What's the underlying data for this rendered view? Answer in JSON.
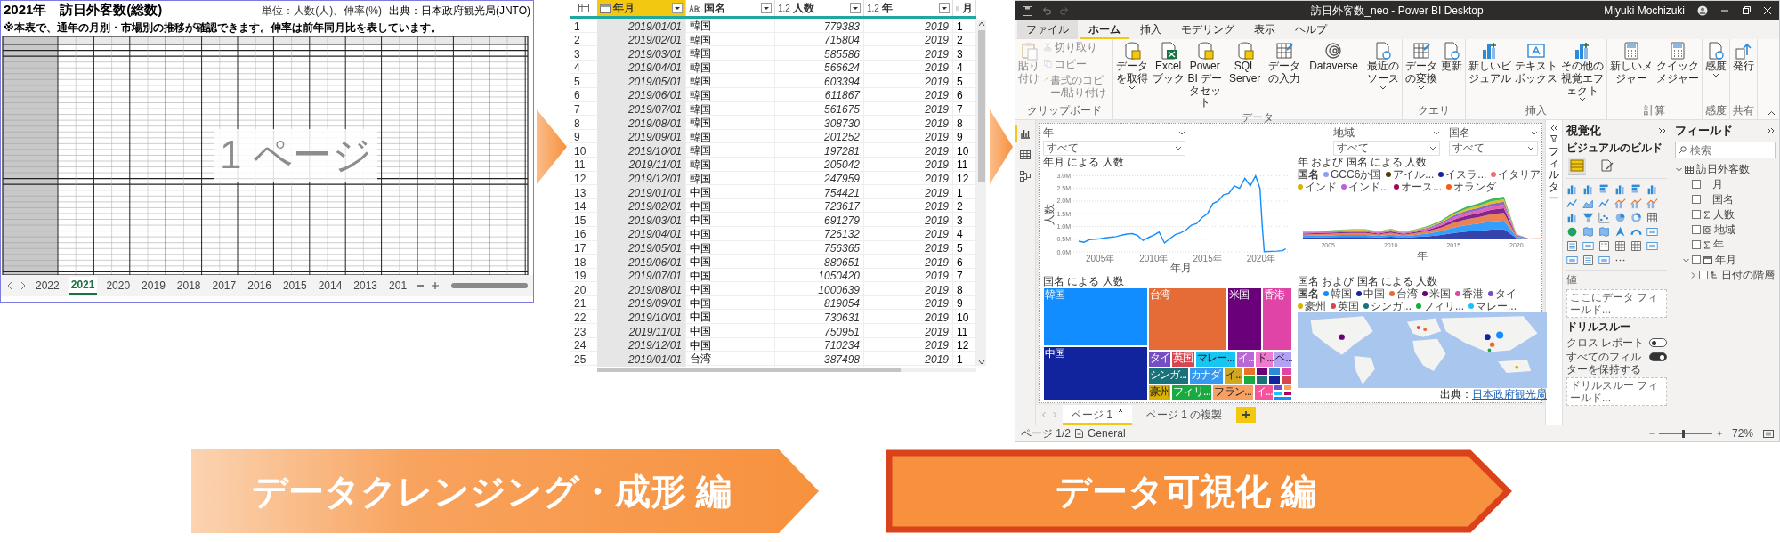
{
  "excel": {
    "title": "2021年　訪日外客数(総数)",
    "source": "出典：日本政府観光局(JNTO)",
    "note": "※本表で、通年の月別・市場別の推移が確認できます。伸率は前年同月比を表しています。",
    "unit": "単位：人数(人)、伸率(%)",
    "page_label": "1 ページ",
    "sheet_tabs": [
      {
        "label": "2022",
        "selected": false
      },
      {
        "label": "2021",
        "selected": true
      },
      {
        "label": "2020",
        "selected": false
      },
      {
        "label": "2019",
        "selected": false
      },
      {
        "label": "2018",
        "selected": false
      },
      {
        "label": "2017",
        "selected": false
      },
      {
        "label": "2016",
        "selected": false
      },
      {
        "label": "2015",
        "selected": false
      },
      {
        "label": "2014",
        "selected": false
      },
      {
        "label": "2013",
        "selected": false
      },
      {
        "label": "201",
        "selected": false
      }
    ]
  },
  "query_editor": {
    "columns": [
      {
        "kind": "date",
        "name": "年月",
        "selected": true,
        "menu": true
      },
      {
        "kind": "text",
        "name": "国名",
        "selected": false,
        "menu": true
      },
      {
        "kind": "number",
        "type_label": "1.2",
        "name": "人数",
        "selected": false,
        "menu": true
      },
      {
        "kind": "number",
        "type_label": "1.2",
        "name": "年",
        "selected": false,
        "menu": true
      },
      {
        "kind": "any",
        "name": "月",
        "selected": false,
        "menu": false
      }
    ],
    "rows": [
      {
        "index": "1",
        "cells": [
          "2019/01/01",
          "韓国",
          "779383",
          "2019",
          "1"
        ]
      },
      {
        "index": "2",
        "cells": [
          "2019/02/01",
          "韓国",
          "715804",
          "2019",
          "2"
        ]
      },
      {
        "index": "3",
        "cells": [
          "2019/03/01",
          "韓国",
          "585586",
          "2019",
          "3"
        ]
      },
      {
        "index": "4",
        "cells": [
          "2019/04/01",
          "韓国",
          "566624",
          "2019",
          "4"
        ]
      },
      {
        "index": "5",
        "cells": [
          "2019/05/01",
          "韓国",
          "603394",
          "2019",
          "5"
        ]
      },
      {
        "index": "6",
        "cells": [
          "2019/06/01",
          "韓国",
          "611867",
          "2019",
          "6"
        ]
      },
      {
        "index": "7",
        "cells": [
          "2019/07/01",
          "韓国",
          "561675",
          "2019",
          "7"
        ]
      },
      {
        "index": "8",
        "cells": [
          "2019/08/01",
          "韓国",
          "308730",
          "2019",
          "8"
        ]
      },
      {
        "index": "9",
        "cells": [
          "2019/09/01",
          "韓国",
          "201252",
          "2019",
          "9"
        ]
      },
      {
        "index": "10",
        "cells": [
          "2019/10/01",
          "韓国",
          "197281",
          "2019",
          "10"
        ]
      },
      {
        "index": "11",
        "cells": [
          "2019/11/01",
          "韓国",
          "205042",
          "2019",
          "11"
        ]
      },
      {
        "index": "12",
        "cells": [
          "2019/12/01",
          "韓国",
          "247959",
          "2019",
          "12"
        ]
      },
      {
        "index": "13",
        "cells": [
          "2019/01/01",
          "中国",
          "754421",
          "2019",
          "1"
        ]
      },
      {
        "index": "14",
        "cells": [
          "2019/02/01",
          "中国",
          "723617",
          "2019",
          "2"
        ]
      },
      {
        "index": "15",
        "cells": [
          "2019/03/01",
          "中国",
          "691279",
          "2019",
          "3"
        ]
      },
      {
        "index": "16",
        "cells": [
          "2019/04/01",
          "中国",
          "726132",
          "2019",
          "4"
        ]
      },
      {
        "index": "17",
        "cells": [
          "2019/05/01",
          "中国",
          "756365",
          "2019",
          "5"
        ]
      },
      {
        "index": "18",
        "cells": [
          "2019/06/01",
          "中国",
          "880651",
          "2019",
          "6"
        ]
      },
      {
        "index": "19",
        "cells": [
          "2019/07/01",
          "中国",
          "1050420",
          "2019",
          "7"
        ]
      },
      {
        "index": "20",
        "cells": [
          "2019/08/01",
          "中国",
          "1000639",
          "2019",
          "8"
        ]
      },
      {
        "index": "21",
        "cells": [
          "2019/09/01",
          "中国",
          "819054",
          "2019",
          "9"
        ]
      },
      {
        "index": "22",
        "cells": [
          "2019/10/01",
          "中国",
          "730631",
          "2019",
          "10"
        ]
      },
      {
        "index": "23",
        "cells": [
          "2019/11/01",
          "中国",
          "750951",
          "2019",
          "11"
        ]
      },
      {
        "index": "24",
        "cells": [
          "2019/12/01",
          "中国",
          "710234",
          "2019",
          "12"
        ]
      },
      {
        "index": "25",
        "cells": [
          "2019/01/01",
          "台湾",
          "387498",
          "2019",
          "1"
        ]
      }
    ]
  },
  "power_bi": {
    "title": "訪日外客数_neo - Power BI Desktop",
    "user": "Miyuki Mochizuki",
    "tabs": [
      {
        "label": "ファイル",
        "kind": "file",
        "selected": false
      },
      {
        "label": "ホーム",
        "kind": "tab",
        "selected": true
      },
      {
        "label": "挿入",
        "kind": "tab",
        "selected": false
      },
      {
        "label": "モデリング",
        "kind": "tab",
        "selected": false
      },
      {
        "label": "表示",
        "kind": "tab",
        "selected": false
      },
      {
        "label": "ヘルプ",
        "kind": "tab",
        "selected": false
      }
    ],
    "ribbon": [
      {
        "label": "クリップボード",
        "buttons": [
          {
            "kind": "large",
            "label": "貼り付け",
            "disabled": true
          },
          {
            "kind": "small",
            "label": "切り取り",
            "disabled": true
          },
          {
            "kind": "small",
            "label": "コピー",
            "disabled": true
          },
          {
            "kind": "small",
            "label": "書式のコピー/貼り付け",
            "disabled": true
          }
        ]
      },
      {
        "label": "データ",
        "buttons": [
          {
            "kind": "large",
            "label": "データを取得",
            "menu": true
          },
          {
            "kind": "large",
            "label": "Excel ブック"
          },
          {
            "kind": "large",
            "label": "Power BI データセット"
          },
          {
            "kind": "large",
            "label": "SQL Server"
          },
          {
            "kind": "large",
            "label": "データの入力"
          },
          {
            "kind": "large",
            "label": "Dataverse"
          },
          {
            "kind": "large",
            "label": "最近のソース",
            "menu": true
          }
        ]
      },
      {
        "label": "クエリ",
        "buttons": [
          {
            "kind": "large",
            "label": "データの変換",
            "menu": true
          },
          {
            "kind": "large",
            "label": "更新"
          }
        ]
      },
      {
        "label": "挿入",
        "buttons": [
          {
            "kind": "large",
            "label": "新しいビジュアル"
          },
          {
            "kind": "large",
            "label": "テキストボックス"
          },
          {
            "kind": "large",
            "label": "その他の視覚エフェクト",
            "menu": true
          }
        ]
      },
      {
        "label": "計算",
        "buttons": [
          {
            "kind": "large",
            "label": "新しいメジャー"
          },
          {
            "kind": "large",
            "label": "クイックメジャー"
          }
        ]
      },
      {
        "label": "感度",
        "buttons": [
          {
            "kind": "large",
            "label": "感度",
            "menu": true
          }
        ]
      },
      {
        "label": "共有",
        "buttons": [
          {
            "kind": "large",
            "label": "発行"
          }
        ]
      }
    ],
    "views": [
      {
        "kind": "report",
        "selected": true
      },
      {
        "kind": "data",
        "selected": false
      },
      {
        "kind": "model",
        "selected": false
      }
    ],
    "slicers": [
      {
        "label": "年",
        "value": "すべて"
      },
      {
        "label": "地域",
        "value": "すべて"
      },
      {
        "label": "国名",
        "value": "すべて"
      }
    ],
    "line_chart": {
      "title": "年月 による 人数",
      "chart_data": {
        "type": "line",
        "xlabel": "年月",
        "ylabel": "人数",
        "grid": true,
        "x": [
          2003,
          2003.5,
          2004,
          2004.5,
          2005,
          2005.5,
          2006,
          2006.5,
          2007,
          2007.5,
          2008,
          2008.5,
          2009,
          2009.5,
          2010,
          2010.5,
          2011,
          2011.5,
          2012,
          2012.5,
          2013,
          2013.5,
          2014,
          2014.5,
          2015,
          2015.5,
          2016,
          2016.5,
          2017,
          2017.5,
          2018,
          2018.5,
          2019,
          2019.5,
          2019.9,
          2020.1,
          2020.3,
          2021,
          2021.5,
          2022,
          2022.3
        ],
        "series": [
          {
            "color": "#118dff",
            "values": [
              0.42,
              0.38,
              0.48,
              0.5,
              0.52,
              0.55,
              0.58,
              0.6,
              0.66,
              0.7,
              0.72,
              0.64,
              0.45,
              0.56,
              0.66,
              0.78,
              0.35,
              0.52,
              0.68,
              0.75,
              0.86,
              1.05,
              1.12,
              1.35,
              1.5,
              1.9,
              2.0,
              2.25,
              2.3,
              2.6,
              2.5,
              2.9,
              2.6,
              3.0,
              2.5,
              1.1,
              0.01,
              0.02,
              0.03,
              0.05,
              0.12
            ]
          }
        ],
        "xlim": [
          2002.5,
          2022.5
        ],
        "ylim": [
          0,
          3.05
        ],
        "xticks": [
          {
            "value": 2005,
            "label": "2005年"
          },
          {
            "value": 2010,
            "label": "2010年"
          },
          {
            "value": 2015,
            "label": "2015年"
          },
          {
            "value": 2020,
            "label": "2020年"
          }
        ],
        "yticks": [
          {
            "value": 0,
            "label": "0.0M"
          },
          {
            "value": 0.5,
            "label": "0.5M"
          },
          {
            "value": 1,
            "label": "1.0M"
          },
          {
            "value": 1.5,
            "label": "1.5M"
          },
          {
            "value": 2,
            "label": "2.0M"
          },
          {
            "value": 2.5,
            "label": "2.5M"
          },
          {
            "value": 3,
            "label": "3.0M"
          }
        ]
      }
    },
    "area_chart": {
      "title": "年 および 国名 による 人数",
      "legend_title": "国名",
      "legend": [
        {
          "label": "GCC6か国",
          "color": "#8c9ef0"
        },
        {
          "label": "アイル...",
          "color": "#4d3b00"
        },
        {
          "label": "イスラ...",
          "color": "#12239e"
        },
        {
          "label": "イタリア",
          "color": "#f46b6b"
        },
        {
          "label": "インド",
          "color": "#d9b300"
        },
        {
          "label": "インド...",
          "color": "#c05ee0"
        },
        {
          "label": "オース...",
          "color": "#a8005a"
        },
        {
          "label": "オランダ",
          "color": "#f95d0a"
        }
      ],
      "xticks": [
        "2005",
        "2010",
        "2015",
        "2020"
      ],
      "xlabel": "年"
    },
    "treemap": {
      "title": "国名 による 人数",
      "items": [
        {
          "label": "韓国",
          "color": "#118dff"
        },
        {
          "label": "台湾",
          "color": "#e66c37"
        },
        {
          "label": "米国",
          "color": "#6b007b"
        },
        {
          "label": "香港",
          "color": "#e044a7"
        },
        {
          "label": "中国",
          "color": "#12239e"
        },
        {
          "label": "タイ",
          "color": "#744ec2"
        },
        {
          "label": "英国",
          "color": "#d64550"
        },
        {
          "label": "マレー...",
          "color": "#15c6f4"
        },
        {
          "label": "イ...",
          "color": "#b967d6"
        },
        {
          "label": "ド...",
          "color": "#f279d2"
        },
        {
          "label": "ベ...",
          "color": "#b3a1f5"
        },
        {
          "label": "シンガ...",
          "color": "#197278"
        },
        {
          "label": "カナダ",
          "color": "#3599f0"
        },
        {
          "label": "イ...",
          "color": "#cfa81f"
        },
        {
          "label": "豪州",
          "color": "#d9b300"
        },
        {
          "label": "フィリ...",
          "color": "#1aab40"
        },
        {
          "label": "フラン...",
          "color": "#f7a062"
        },
        {
          "label": "イ...",
          "color": "#f5539a"
        }
      ]
    },
    "map": {
      "title": "国名 および 国名 による 人数",
      "legend_title": "国名",
      "legend": [
        {
          "label": "韓国",
          "color": "#118dff"
        },
        {
          "label": "中国",
          "color": "#12239e"
        },
        {
          "label": "台湾",
          "color": "#e66c37"
        },
        {
          "label": "米国",
          "color": "#6b007b"
        },
        {
          "label": "香港",
          "color": "#e044a7"
        },
        {
          "label": "タイ",
          "color": "#744ec2"
        },
        {
          "label": "豪州",
          "color": "#d9b300"
        },
        {
          "label": "英国",
          "color": "#d64550"
        },
        {
          "label": "シンガ...",
          "color": "#197278"
        },
        {
          "label": "フィリ...",
          "color": "#1aab40"
        },
        {
          "label": "マレー...",
          "color": "#15c6f4"
        }
      ]
    },
    "source_prefix": "出典：",
    "source_link": "日本政府観光局",
    "filters_label": "フィルター",
    "viz": {
      "title": "視覚化",
      "subtitle": "ビジュアルのビルド",
      "build_tabs": [
        {
          "selected": true
        },
        {
          "selected": false
        }
      ],
      "values_label": "値",
      "values_well": "ここにデータ フィールド...",
      "drill_title": "ドリルスルー",
      "toggles": [
        {
          "label": "クロス レポート",
          "on": false
        },
        {
          "label": "すべてのフィルターを保持する",
          "on": true
        }
      ],
      "drill_well": "ドリルスルー フィールド..."
    },
    "fields": {
      "title": "フィールド",
      "search_placeholder": "検索",
      "tree": [
        {
          "label": "訪日外客数",
          "kind": "table",
          "expanded": true,
          "children": [
            {
              "label": "月",
              "kind": "text",
              "checked": false
            },
            {
              "label": "国名",
              "kind": "text",
              "checked": false
            },
            {
              "label": "人数",
              "kind": "sum",
              "checked": false
            },
            {
              "label": "地域",
              "kind": "geo",
              "checked": false
            },
            {
              "label": "年",
              "kind": "sum",
              "checked": false
            },
            {
              "label": "年月",
              "kind": "date",
              "checked": false,
              "expanded": true,
              "children": [
                {
                  "label": "日付の階層",
                  "kind": "hierarchy",
                  "checked": false,
                  "expanded": false
                }
              ]
            }
          ]
        }
      ]
    },
    "page_tabs": [
      {
        "label": "ページ 1",
        "selected": true,
        "closable": true
      },
      {
        "label": "ページ 1 の複製",
        "selected": false,
        "closable": false
      }
    ],
    "status": {
      "page": "ページ 1/2",
      "sensitivity": "General",
      "zoom": "72%",
      "zoom_slider": {
        "level": 0.45
      }
    }
  },
  "banners": [
    {
      "label": "データクレンジング・成形 編",
      "kind": "gradient"
    },
    {
      "label": "データ可視化 編",
      "kind": "outlined"
    }
  ]
}
